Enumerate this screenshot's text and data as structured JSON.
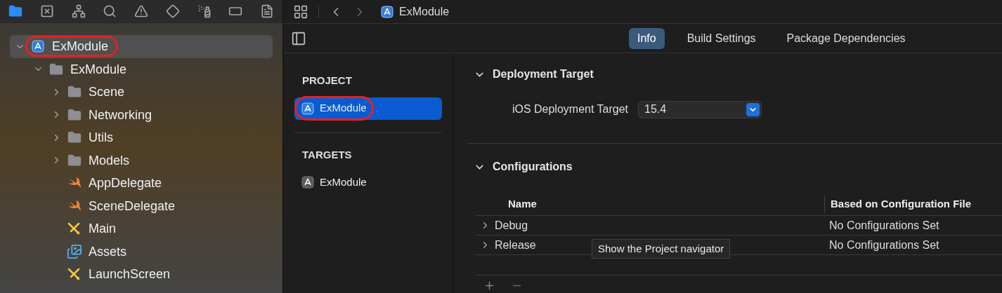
{
  "navigator": {
    "tabs": [
      {
        "kind": "folder",
        "selected": true
      },
      {
        "kind": "source-control",
        "selected": false
      },
      {
        "kind": "hierarchy",
        "selected": false
      },
      {
        "kind": "search",
        "selected": false
      },
      {
        "kind": "warning",
        "selected": false
      },
      {
        "kind": "test",
        "selected": false
      },
      {
        "kind": "debug",
        "selected": false
      },
      {
        "kind": "breakpoint",
        "selected": false
      },
      {
        "kind": "report",
        "selected": false
      }
    ],
    "tree": [
      {
        "label": "ExModule",
        "kind": "project",
        "expanded": true,
        "selected": true,
        "annotated": true,
        "children": [
          {
            "label": "ExModule",
            "kind": "folder",
            "expanded": true,
            "selected": false,
            "annotated": false,
            "children": [
              {
                "label": "Scene",
                "kind": "folder",
                "expanded": false,
                "selected": false,
                "annotated": false
              },
              {
                "label": "Networking",
                "kind": "folder",
                "expanded": false,
                "selected": false,
                "annotated": false
              },
              {
                "label": "Utils",
                "kind": "folder",
                "expanded": false,
                "selected": false,
                "annotated": false
              },
              {
                "label": "Models",
                "kind": "folder",
                "expanded": false,
                "selected": false,
                "annotated": false
              },
              {
                "label": "AppDelegate",
                "kind": "swift",
                "selected": false,
                "annotated": false
              },
              {
                "label": "SceneDelegate",
                "kind": "swift",
                "selected": false,
                "annotated": false
              },
              {
                "label": "Main",
                "kind": "storyboard",
                "selected": false,
                "annotated": false
              },
              {
                "label": "Assets",
                "kind": "assets",
                "selected": false,
                "annotated": false
              },
              {
                "label": "LaunchScreen",
                "kind": "storyboard",
                "selected": false,
                "annotated": false
              }
            ]
          }
        ]
      }
    ]
  },
  "editor": {
    "breadcrumb": "ExModule",
    "tabs": [
      {
        "label": "Info",
        "selected": true
      },
      {
        "label": "Build Settings",
        "selected": false
      },
      {
        "label": "Package Dependencies",
        "selected": false
      }
    ],
    "project_list": [
      {
        "title": "PROJECT",
        "items": [
          {
            "label": "ExModule",
            "kind": "project",
            "selected": true,
            "annotated": true
          }
        ]
      },
      {
        "title": "TARGETS",
        "items": [
          {
            "label": "ExModule",
            "kind": "target",
            "selected": false,
            "annotated": false
          }
        ]
      }
    ],
    "sections": [
      {
        "kind": "deployment",
        "title": "Deployment Target",
        "expanded": true,
        "field_label": "iOS Deployment Target",
        "value": "15.4"
      },
      {
        "kind": "configurations",
        "title": "Configurations",
        "expanded": true,
        "columns": [
          "Name",
          "Based on Configuration File"
        ],
        "rows": [
          {
            "name": "Debug",
            "file": "No Configurations Set",
            "expanded": false
          },
          {
            "name": "Release",
            "file": "No Configurations Set",
            "expanded": false
          }
        ]
      }
    ],
    "tooltip": "Show the Project navigator"
  }
}
